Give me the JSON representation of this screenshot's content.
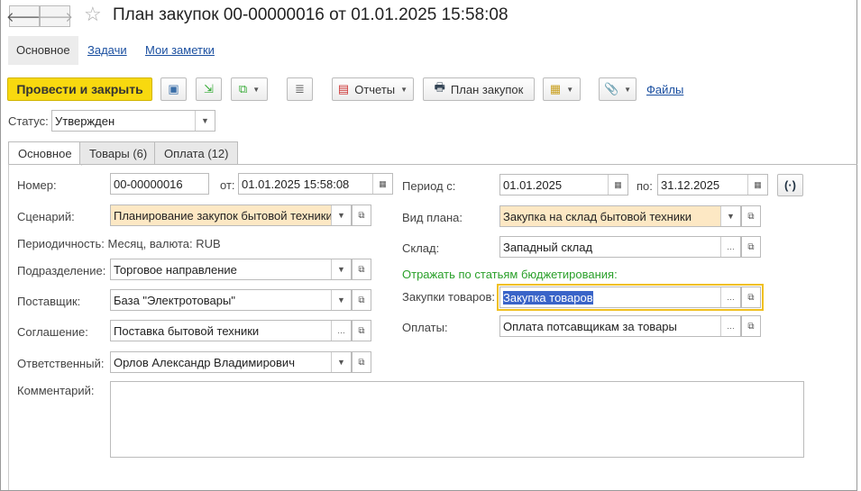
{
  "window": {
    "title": "План закупок 00-00000016 от 01.01.2025 15:58:08"
  },
  "top_tabs": [
    "Основное",
    "Задачи",
    "Мои заметки"
  ],
  "toolbar": {
    "post_close": "Провести и закрыть",
    "reports": "Отчеты",
    "plan": "План закупок",
    "files": "Файлы"
  },
  "status": {
    "label": "Статус:",
    "value": "Утвержден"
  },
  "form_tabs": [
    "Основное",
    "Товары (6)",
    "Оплата (12)"
  ],
  "left": {
    "number_label": "Номер:",
    "number": "00-00000016",
    "from_label": "от:",
    "date": "01.01.2025 15:58:08",
    "scenario_label": "Сценарий:",
    "scenario": "Планирование закупок бытовой техники",
    "periodicity": "Периодичность: Месяц, валюта: RUB",
    "division_label": "Подразделение:",
    "division": "Торговое направление",
    "supplier_label": "Поставщик:",
    "supplier": "База \"Электротовары\"",
    "agreement_label": "Соглашение:",
    "agreement": "Поставка бытовой техники",
    "responsible_label": "Ответственный:",
    "responsible": "Орлов Александр Владимирович",
    "comment_label": "Комментарий:",
    "comment": ""
  },
  "right": {
    "period_label": "Период с:",
    "period_from": "01.01.2025",
    "to_label": "по:",
    "period_to": "31.12.2025",
    "plan_type_label": "Вид плана:",
    "plan_type": "Закупка на склад бытовой техники",
    "warehouse_label": "Склад:",
    "warehouse": "Западный склад",
    "budget_heading": "Отражать по статьям бюджетирования:",
    "purchases_label": "Закупки товаров:",
    "purchases": "Закупка товаров",
    "payments_label": "Оплаты:",
    "payments": "Оплата потсавщикам за товары"
  },
  "colors": {
    "primary": "#f8d90f",
    "highlight": "#fde8c4",
    "budget_heading": "#2aa02a",
    "focus": "#f0c020",
    "selection": "#3a64c8"
  }
}
